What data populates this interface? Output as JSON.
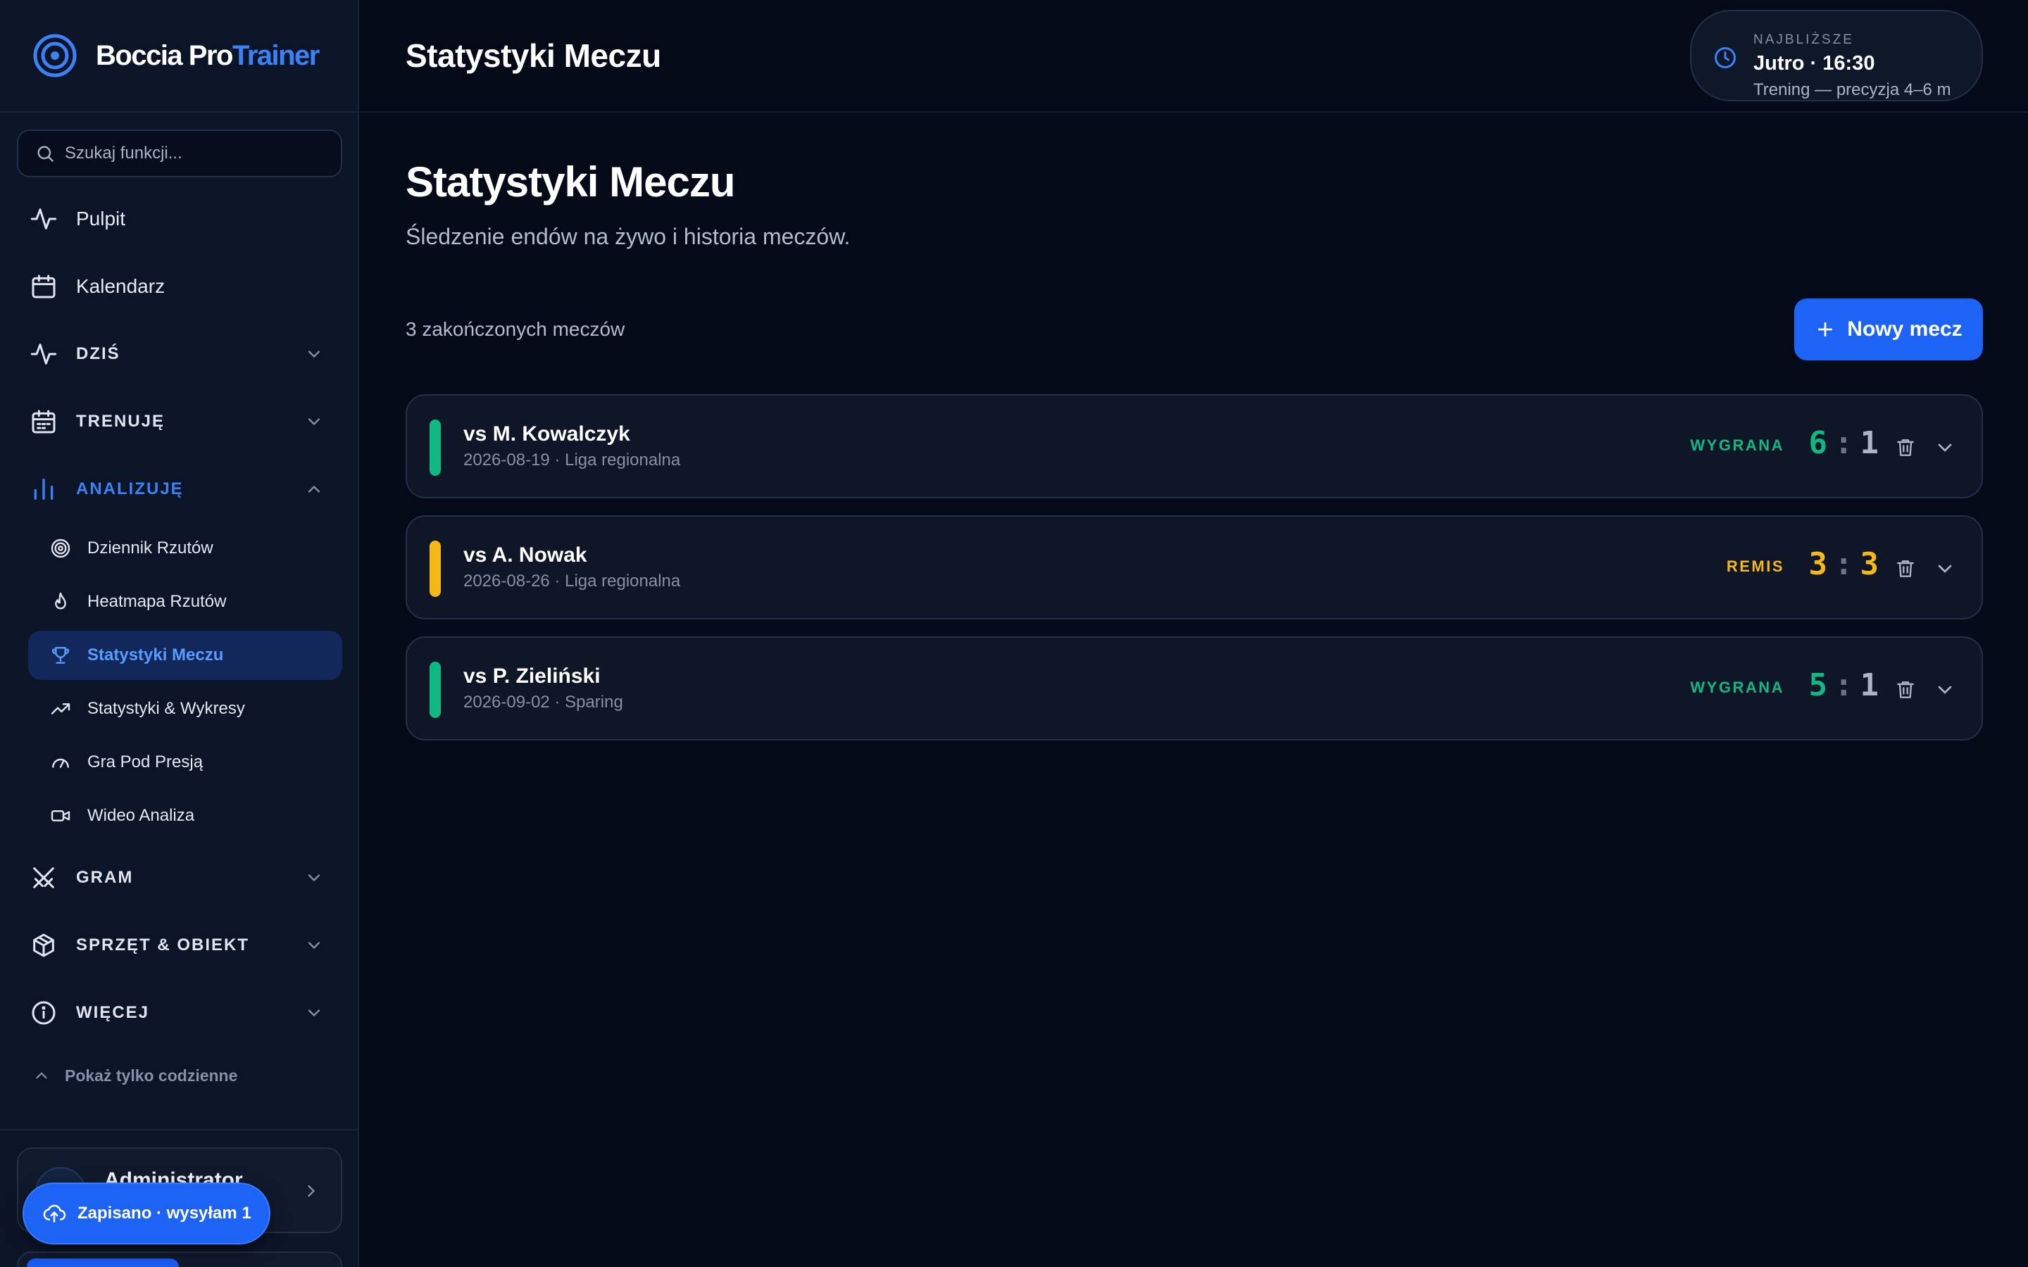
{
  "brand": {
    "name_main": "Boccia Pro",
    "name_accent": "Trainer",
    "accent_color": "#3b82f6"
  },
  "search": {
    "placeholder": "Szukaj funkcji..."
  },
  "nav": {
    "pulpit": "Pulpit",
    "kalendarz": "Kalendarz",
    "sections": {
      "dzis": "DZIŚ",
      "trenuje": "TRENUJĘ",
      "analizuje": "ANALIZUJĘ",
      "gram": "GRAM",
      "sprzet": "SPRZĘT & OBIEKT",
      "wiecej": "WIĘCEJ"
    },
    "analizuje_items": [
      {
        "label": "Dziennik Rzutów",
        "icon": "target-icon"
      },
      {
        "label": "Heatmapa Rzutów",
        "icon": "flame-icon"
      },
      {
        "label": "Statystyki Meczu",
        "icon": "trophy-icon",
        "active": true
      },
      {
        "label": "Statystyki & Wykresy",
        "icon": "trending-up-icon"
      },
      {
        "label": "Gra Pod Presją",
        "icon": "gauge-icon"
      },
      {
        "label": "Wideo Analiza",
        "icon": "video-icon"
      }
    ],
    "toggle_daily": "Pokaż tylko codzienne"
  },
  "user": {
    "name": "Administrator"
  },
  "toast": {
    "label": "Zapisano · wysyłam 1"
  },
  "topbar": {
    "title": "Statystyki Meczu",
    "next": {
      "kicker": "NAJBLIŻSZE",
      "time": "Jutro · 16:30",
      "desc": "Trening — precyzja 4–6 m"
    }
  },
  "main": {
    "title": "Statystyki Meczu",
    "subtitle": "Śledzenie endów na żywo i historia meczów.",
    "count_label": "3 zakończonych meczów",
    "new_button": "Nowy mecz"
  },
  "matches": [
    {
      "opponent": "vs M. Kowalczyk",
      "meta": "2026-08-19 · Liga regionalna",
      "result": "WYGRANA",
      "score_own": "6",
      "score_opp": "1",
      "status": "win"
    },
    {
      "opponent": "vs A. Nowak",
      "meta": "2026-08-26 · Liga regionalna",
      "result": "REMIS",
      "score_own": "3",
      "score_opp": "3",
      "status": "draw"
    },
    {
      "opponent": "vs P. Zieliński",
      "meta": "2026-09-02 · Sparing",
      "result": "WYGRANA",
      "score_own": "5",
      "score_opp": "1",
      "status": "win"
    }
  ],
  "colors": {
    "win": "#10b981",
    "draw": "#f5b816",
    "primary": "#1d63f5",
    "background": "#050a18"
  }
}
